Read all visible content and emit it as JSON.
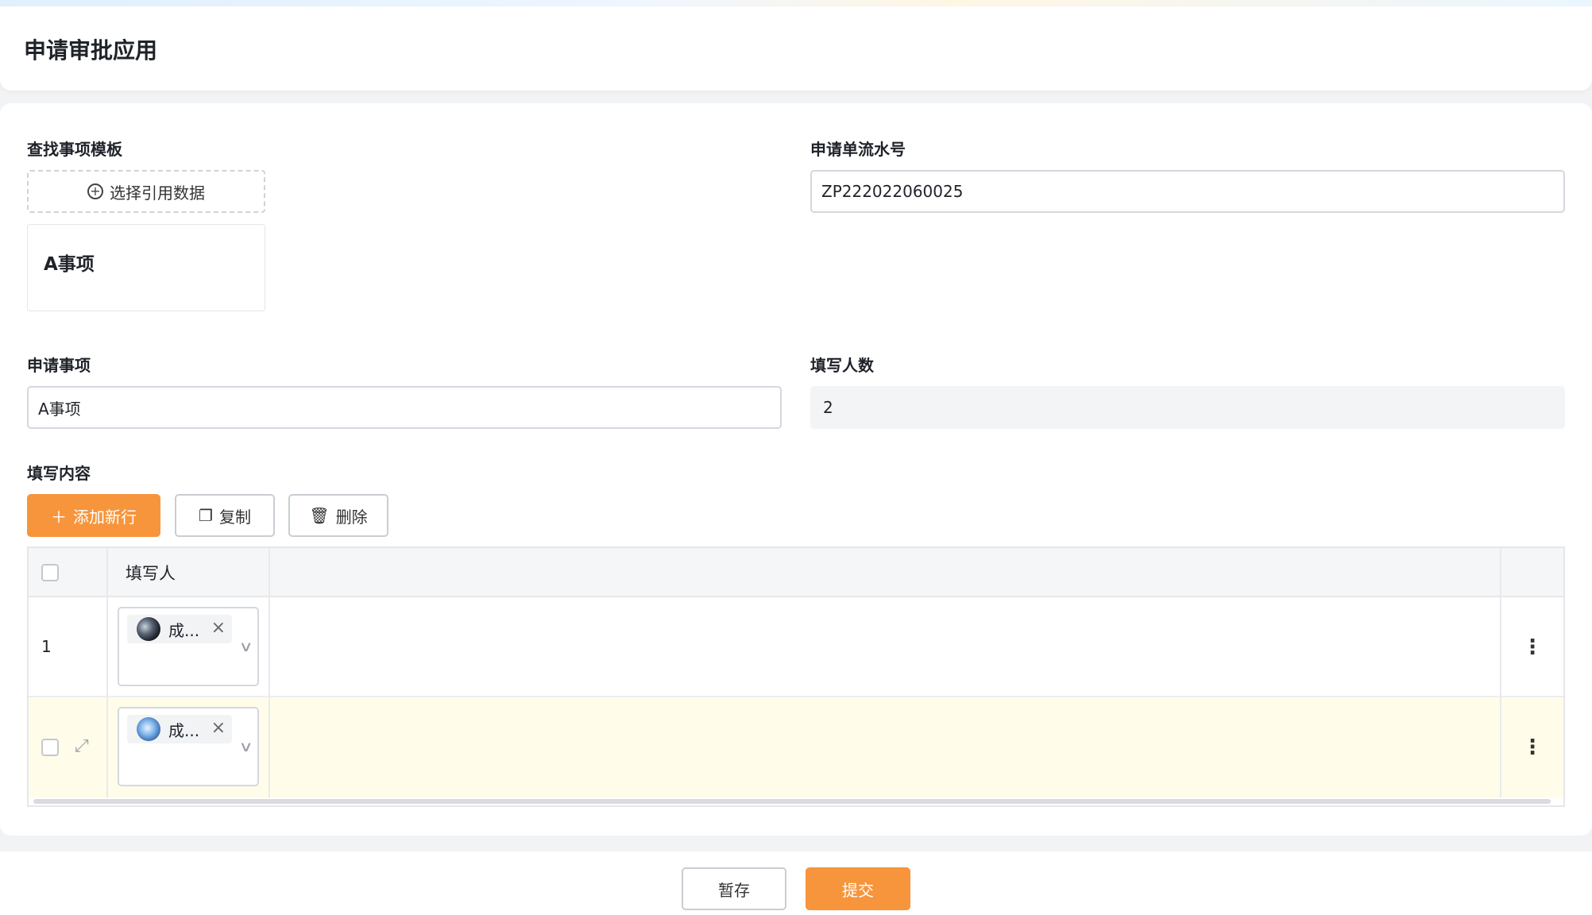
{
  "header": {
    "title": "申请审批应用"
  },
  "form": {
    "template_label": "查找事项模板",
    "select_ref_label": "选择引用数据",
    "selected_template": "A事项",
    "serial_label": "申请单流水号",
    "serial_value": "ZP222022060025",
    "item_label": "申请事项",
    "item_value": "A事项",
    "count_label": "填写人数",
    "count_value": "2",
    "content_label": "填写内容"
  },
  "toolbar": {
    "add_label": "添加新行",
    "copy_label": "复制",
    "delete_label": "删除"
  },
  "table": {
    "column_header": "填写人",
    "rows": [
      {
        "index": "1",
        "person": "成..."
      },
      {
        "index": "",
        "person": "成..."
      }
    ]
  },
  "footer": {
    "save_label": "暂存",
    "submit_label": "提交"
  },
  "colors": {
    "accent": "#f7953c",
    "row_highlight": "#fffde9"
  }
}
